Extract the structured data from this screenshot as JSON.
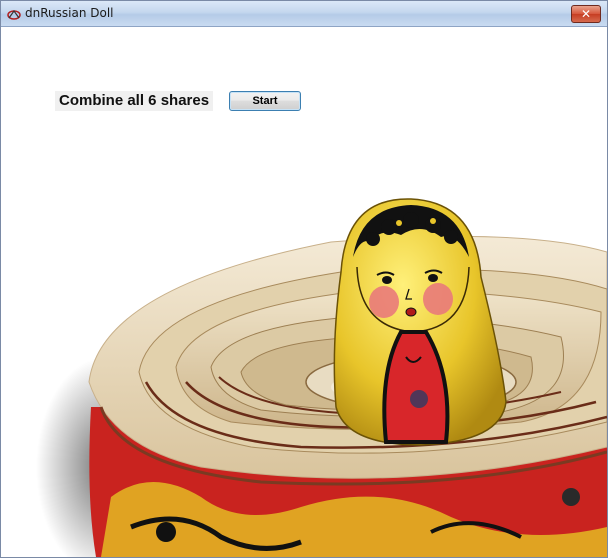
{
  "window": {
    "title": "dnRussian Doll",
    "close_glyph": "✕"
  },
  "main": {
    "instruction_text": "Combine all 6 shares",
    "start_label": "Start"
  },
  "icons": {
    "app": "russian-doll-app-icon",
    "close": "close-icon"
  },
  "colors": {
    "titlebar": "#c4d7ee",
    "close_button": "#d6553a",
    "button_border": "#3c7fb1",
    "doll_yellow": "#e6c52a",
    "doll_red": "#d8262a",
    "wood": "#e9dcc3"
  }
}
